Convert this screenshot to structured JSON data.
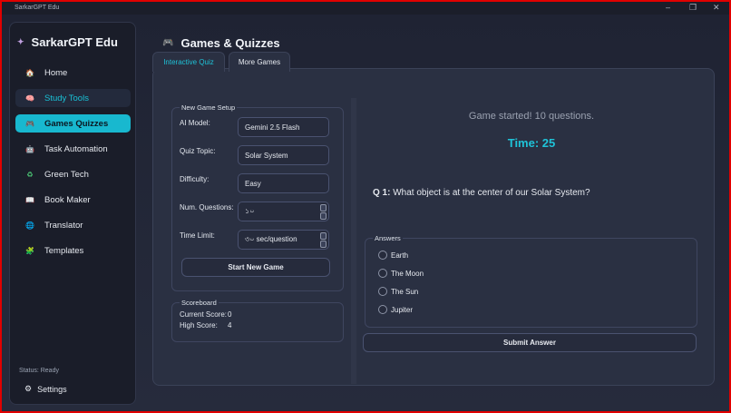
{
  "window": {
    "title": "SarkarGPT Edu",
    "controls": [
      "–",
      "❐",
      "✕"
    ]
  },
  "sidebar": {
    "brand": "SarkarGPT Edu",
    "items": [
      {
        "label": "Home",
        "icon": "home-icon",
        "glyph": "🏠"
      },
      {
        "label": "Study Tools",
        "icon": "brain-icon",
        "glyph": "🧠"
      },
      {
        "label": "Games  Quizzes",
        "icon": "gamepad-icon",
        "glyph": "🎮"
      },
      {
        "label": "Task Automation",
        "icon": "robot-icon",
        "glyph": "🤖"
      },
      {
        "label": "Green Tech",
        "icon": "recycle-icon",
        "glyph": "♻"
      },
      {
        "label": "Book Maker",
        "icon": "book-icon",
        "glyph": "📖"
      },
      {
        "label": "Translator",
        "icon": "globe-icon",
        "glyph": "🌐"
      },
      {
        "label": "Templates",
        "icon": "puzzle-icon",
        "glyph": "🧩"
      }
    ],
    "status": "Status: Ready",
    "settings_label": "Settings"
  },
  "page": {
    "title": "Games & Quizzes",
    "tabs": [
      "Interactive Quiz",
      "More Games"
    ]
  },
  "setup": {
    "group_label": "New Game Setup",
    "ai_model_label": "AI Model:",
    "ai_model_value": "Gemini 2.5 Flash",
    "topic_label": "Quiz Topic:",
    "topic_value": "Solar System",
    "difficulty_label": "Difficulty:",
    "difficulty_value": "Easy",
    "num_label": "Num. Questions:",
    "num_value": "১০",
    "time_label": "Time Limit:",
    "time_value": "৩০ sec/question",
    "start_button": "Start New Game"
  },
  "scoreboard": {
    "group_label": "Scoreboard",
    "current_label": "Current Score:",
    "current_value": "0",
    "high_label": "High Score:",
    "high_value": "4"
  },
  "game": {
    "status": "Game started! 10 questions.",
    "timer": "Time: 25",
    "question_number": "Q 1:",
    "question_text": "What object is at the center of our Solar System?",
    "answers_label": "Answers",
    "options": [
      "Earth",
      "The Moon",
      "The Sun",
      "Jupiter"
    ],
    "submit_button": "Submit Answer"
  },
  "colors": {
    "accent": "#18b8cf",
    "background": "#1e2230",
    "panel": "#2a3042"
  }
}
